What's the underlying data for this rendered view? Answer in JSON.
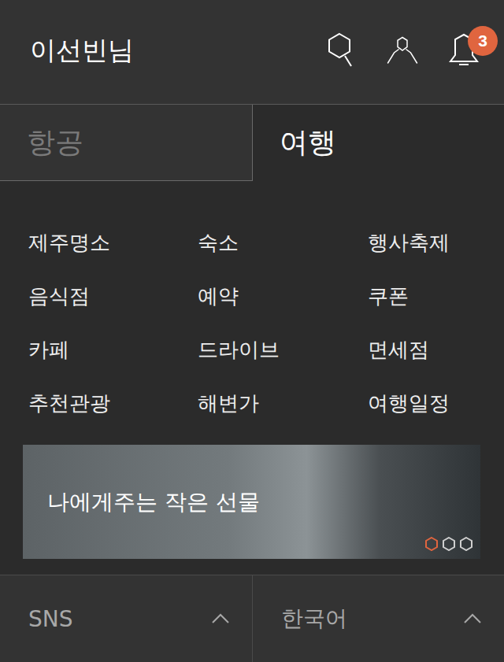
{
  "header": {
    "title": "이선빈님",
    "notification_count": "3"
  },
  "tabs": [
    {
      "label": "항공",
      "selected": false
    },
    {
      "label": "여행",
      "selected": true
    }
  ],
  "menu": [
    "제주명소",
    "숙소",
    "행사축제",
    "음식점",
    "예약",
    "쿠폰",
    "카페",
    "드라이브",
    "면세점",
    "추천관광",
    "해변가",
    "여행일정"
  ],
  "banner": {
    "title": "나에게주는 작은 선물",
    "slides": [
      {
        "selected": true
      },
      {
        "selected": false
      },
      {
        "selected": false
      }
    ]
  },
  "footer": [
    {
      "label": "SNS",
      "expanded": true
    },
    {
      "label": "한국어",
      "expanded": true
    }
  ]
}
